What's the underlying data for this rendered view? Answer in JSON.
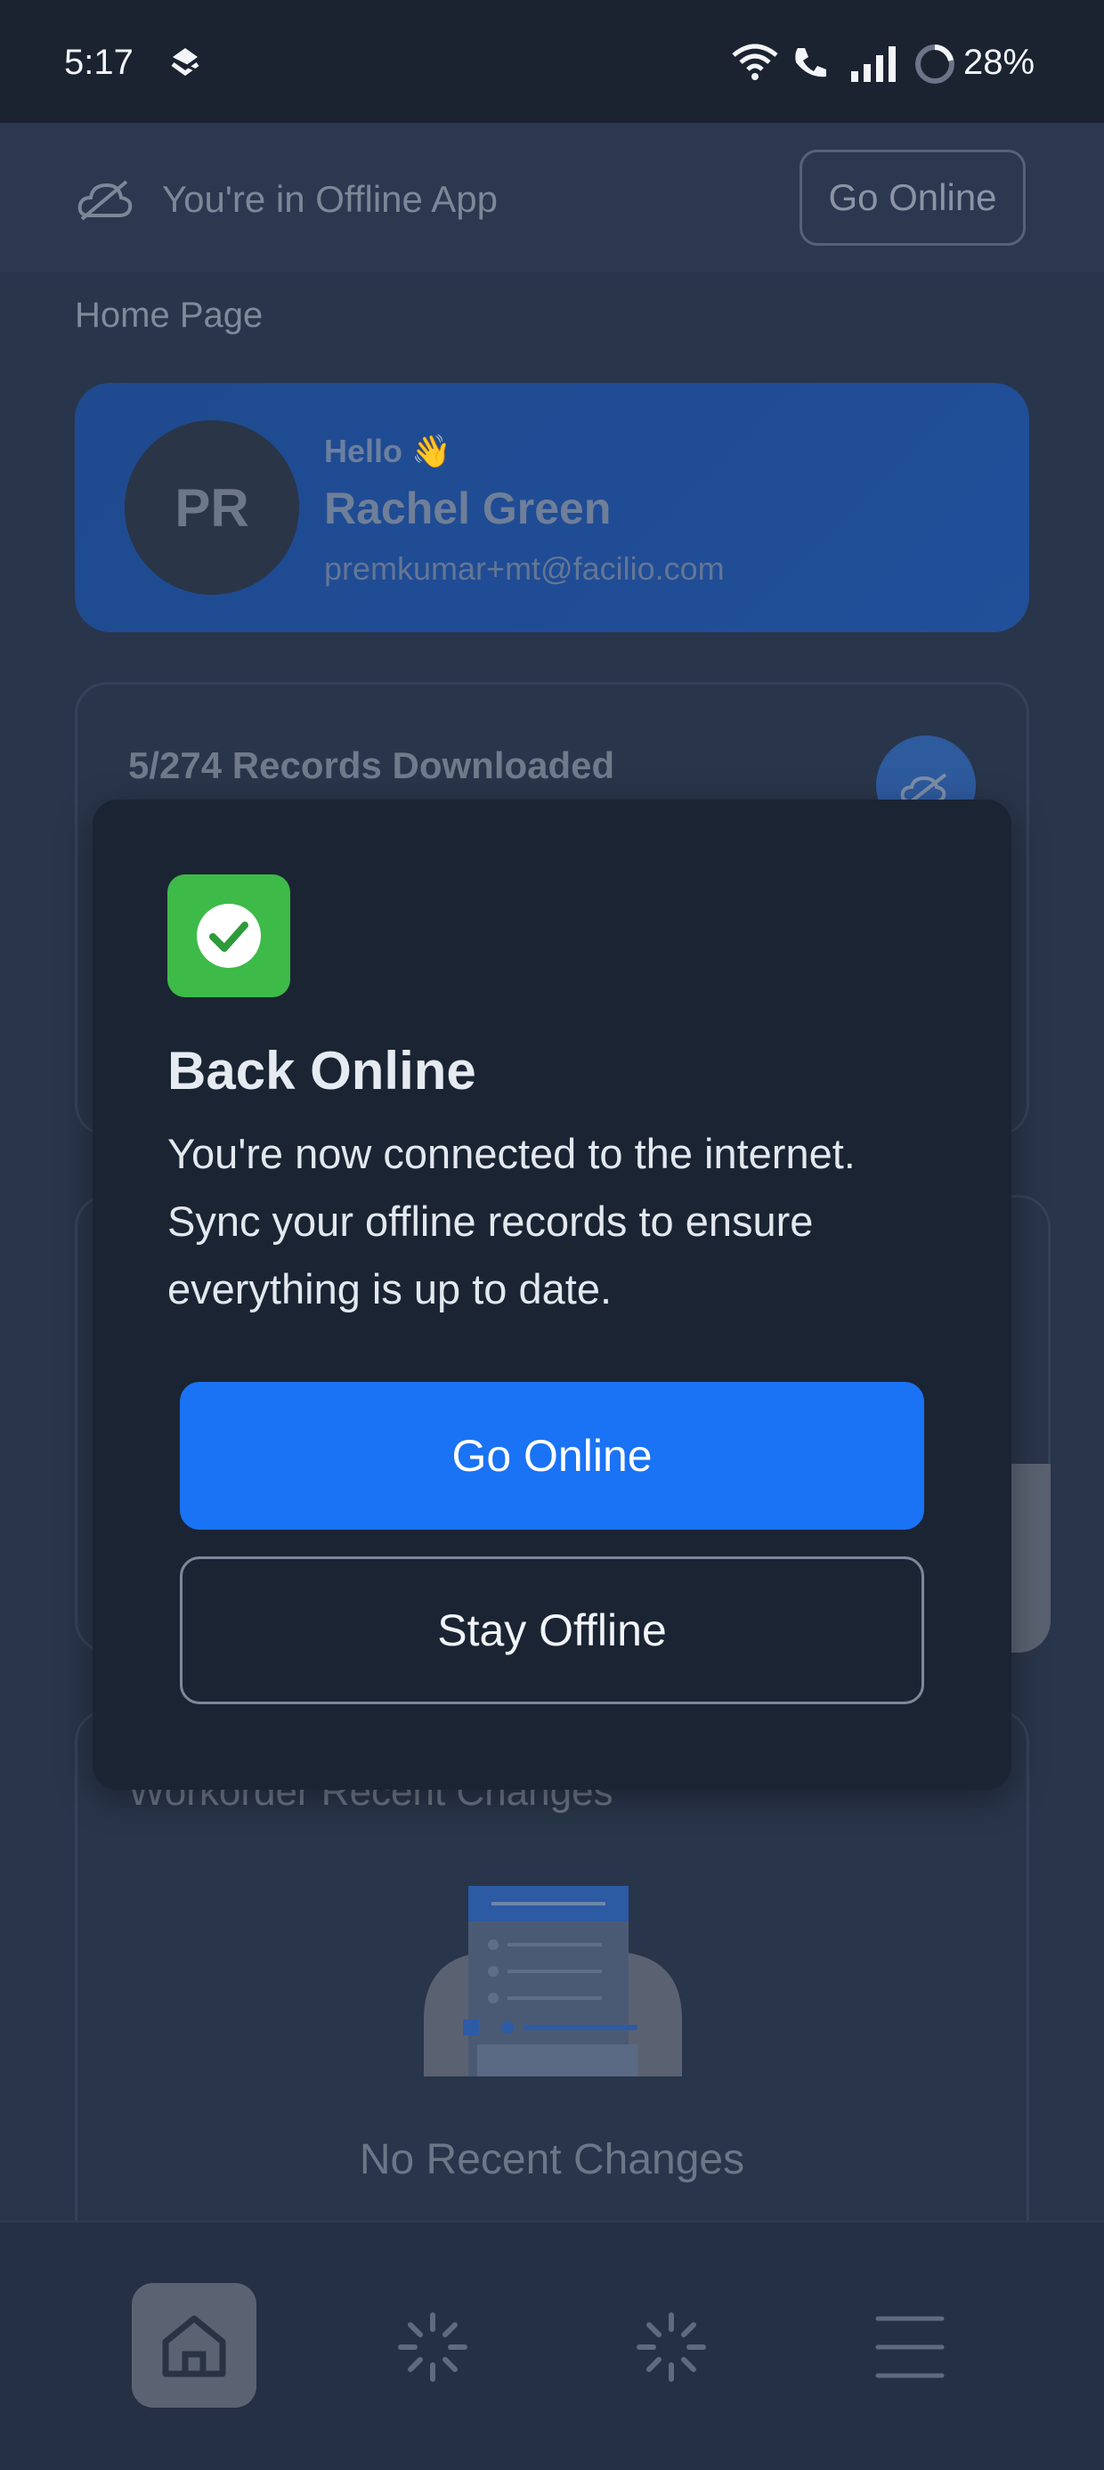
{
  "status_bar": {
    "time": "5:17",
    "battery": "28%",
    "icons": [
      "app-notification-icon",
      "wifi-icon",
      "wifi-call-icon",
      "signal-icon",
      "battery-ring-icon"
    ]
  },
  "offline_bar": {
    "message": "You're in Offline App",
    "go_online_label": "Go Online",
    "icon": "cloud-off-icon"
  },
  "page": {
    "title": "Home Page"
  },
  "profile": {
    "initials": "PR",
    "greeting": "Hello 👋",
    "name": "Rachel Green",
    "email": "premkumar+mt@facilio.com"
  },
  "records": {
    "status": "5/274 Records Downloaded",
    "downloaded": 5,
    "total": 274
  },
  "recent_changes": {
    "title": "Workorder Recent Changes",
    "empty_text": "No Recent Changes"
  },
  "modal": {
    "title": "Back Online",
    "body": "You're now connected to the internet. Sync your offline records to ensure everything is up to date.",
    "primary_label": "Go Online",
    "secondary_label": "Stay Offline"
  },
  "bottom_nav": {
    "items": [
      "home-icon",
      "loading-icon",
      "loading-icon",
      "menu-icon"
    ],
    "active": "home"
  },
  "colors": {
    "background": "#29354a",
    "primary": "#1a73f4",
    "success": "#3dba48",
    "modal": "#1b2433"
  }
}
